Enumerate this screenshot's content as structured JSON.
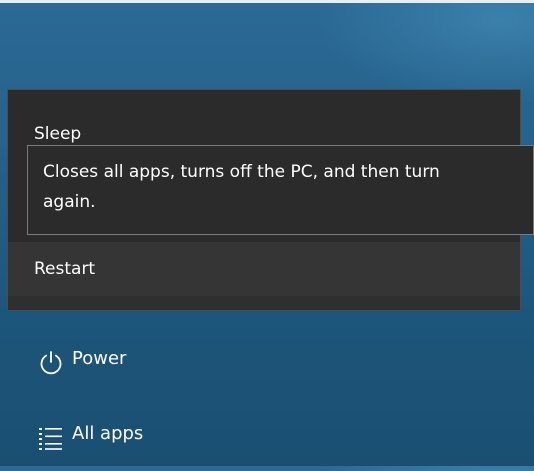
{
  "power_menu": {
    "items": [
      {
        "label": "Sleep"
      },
      {
        "label": "Restart"
      }
    ],
    "tooltip": {
      "line1": "Closes all apps, turns off the PC, and then turn",
      "line2": "again."
    }
  },
  "start_menu": {
    "power_label": "Power",
    "all_apps_label": "All apps",
    "power_icon": "power-icon",
    "all_apps_icon": "list-icon"
  }
}
